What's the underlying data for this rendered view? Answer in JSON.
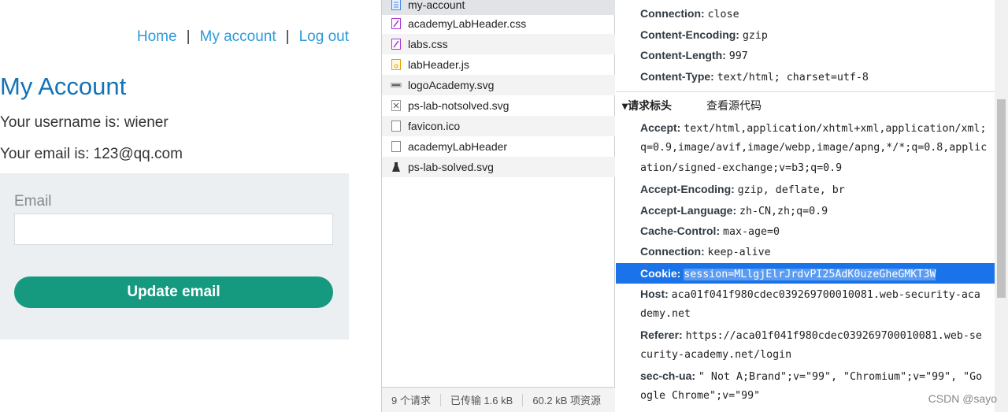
{
  "page": {
    "nav": {
      "home": "Home",
      "sep": "|",
      "account": "My account",
      "logout": "Log out"
    },
    "title": "My Account",
    "username_line": "Your username is: wiener",
    "email_line": "Your email is: 123@qq.com",
    "form": {
      "email_label": "Email",
      "email_value": "",
      "button": "Update email"
    }
  },
  "network": {
    "requests": [
      {
        "name": "my-account",
        "icon": "document-icon",
        "color": "#4a86e8"
      },
      {
        "name": "academyLabHeader.css",
        "icon": "css-file-icon",
        "color": "#a43ad6"
      },
      {
        "name": "labs.css",
        "icon": "css-file-icon",
        "color": "#a43ad6"
      },
      {
        "name": "labHeader.js",
        "icon": "js-file-icon",
        "color": "#e8a200"
      },
      {
        "name": "logoAcademy.svg",
        "icon": "svg-image-icon",
        "color": "#666666"
      },
      {
        "name": "ps-lab-notsolved.svg",
        "icon": "svg-image-icon",
        "color": "#666666"
      },
      {
        "name": "favicon.ico",
        "icon": "blank-file-icon",
        "color": "#888888"
      },
      {
        "name": "academyLabHeader",
        "icon": "blank-file-icon",
        "color": "#888888"
      },
      {
        "name": "ps-lab-solved.svg",
        "icon": "flask-image-icon",
        "color": "#333333"
      }
    ],
    "status": {
      "requests": "9 个请求",
      "transferred": "已传输 1.6 kB",
      "resources": "60.2 kB 项资源"
    }
  },
  "headers": {
    "response_tail": [
      {
        "name": "Connection:",
        "value": "close"
      },
      {
        "name": "Content-Encoding:",
        "value": "gzip"
      },
      {
        "name": "Content-Length:",
        "value": "997"
      },
      {
        "name": "Content-Type:",
        "value": "text/html; charset=utf-8"
      }
    ],
    "section_title": "▾请求标头",
    "view_source": "查看源代码",
    "accept": {
      "name": "Accept:",
      "line1": "text/html,application/xhtml+xml,application/xml;",
      "line2": "q=0.9,image/avif,image/webp,image/apng,*/*;q=0.8,applic",
      "line3": "ation/signed-exchange;v=b3;q=0.9"
    },
    "accept_encoding": {
      "name": "Accept-Encoding:",
      "value": "gzip, deflate, br"
    },
    "accept_language": {
      "name": "Accept-Language:",
      "value": "zh-CN,zh;q=0.9"
    },
    "cache_control": {
      "name": "Cache-Control:",
      "value": "max-age=0"
    },
    "connection": {
      "name": "Connection:",
      "value": "keep-alive"
    },
    "cookie": {
      "name": "Cookie:",
      "value": "session=MLlgjElrJrdvPI25AdK0uzeGheGMKT3W"
    },
    "host": {
      "name": "Host:",
      "line1": "aca01f041f980cdec039269700010081.web-security-aca",
      "line2": "demy.net"
    },
    "referer": {
      "name": "Referer:",
      "line1": "https://aca01f041f980cdec039269700010081.web-se",
      "line2": "curity-academy.net/login"
    },
    "sec_ch_ua": {
      "name": "sec-ch-ua:",
      "line1": "\" Not A;Brand\";v=\"99\", \"Chromium\";v=\"99\", \"Go",
      "line2": "ogle Chrome\";v=\"99\""
    }
  },
  "watermark": "CSDN @sayo"
}
